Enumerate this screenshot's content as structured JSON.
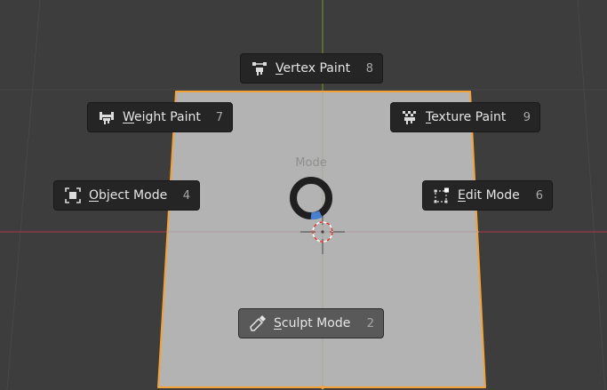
{
  "pie_menu": {
    "title": "Mode",
    "items": [
      {
        "id": "vertex-paint",
        "first": "V",
        "rest": "ertex Paint",
        "key": "8",
        "icon": "vertex-paint-icon"
      },
      {
        "id": "weight-paint",
        "first": "W",
        "rest": "eight Paint",
        "key": "7",
        "icon": "weight-paint-icon"
      },
      {
        "id": "texture-paint",
        "first": "T",
        "rest": "exture Paint",
        "key": "9",
        "icon": "texture-paint-icon"
      },
      {
        "id": "object-mode",
        "first": "O",
        "rest": "bject Mode",
        "key": "4",
        "icon": "object-mode-icon"
      },
      {
        "id": "edit-mode",
        "first": "E",
        "rest": "dit Mode",
        "key": "6",
        "icon": "edit-mode-icon"
      },
      {
        "id": "sculpt-mode",
        "first": "S",
        "rest": "culpt Mode",
        "key": "2",
        "icon": "sculpt-mode-icon",
        "highlighted": true
      }
    ]
  },
  "colors": {
    "viewport_bg": "#3d3d3d",
    "plane": "#b3b3b3",
    "selection_outline": "#f5a236",
    "axis_x": "#9b3a45",
    "axis_y": "#6f8a2c",
    "pie_direction": "#4a7fd0",
    "item_bg": "#252525",
    "item_active_bg": "#595959"
  }
}
